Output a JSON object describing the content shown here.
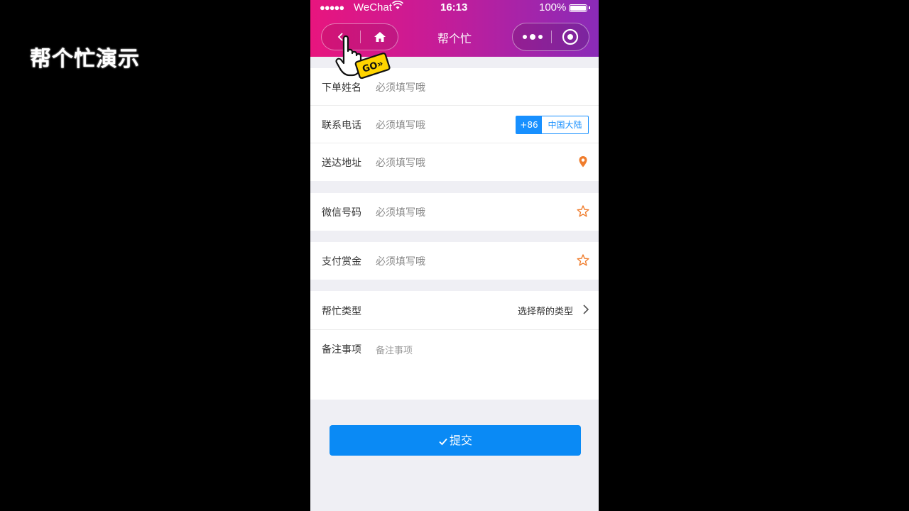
{
  "overlay": {
    "title": "帮个忙演示"
  },
  "status_bar": {
    "signal": "●●●●●",
    "carrier": "WeChat",
    "time": "16:13",
    "battery": "100%"
  },
  "nav": {
    "title": "帮个忙"
  },
  "form": {
    "placeholder": "必须填写哦",
    "name_label": "下单姓名",
    "phone_label": "联系电话",
    "phone_code": "+86",
    "phone_region": "中国大陆",
    "address_label": "送达地址",
    "wechat_label": "微信号码",
    "reward_label": "支付赏金",
    "type_label": "帮忙类型",
    "type_value": "选择帮的类型",
    "notes_label": "备注事项",
    "notes_placeholder": "备注事项"
  },
  "submit": {
    "label": "提交"
  },
  "cursor": {
    "badge": "GO»"
  },
  "colors": {
    "accent": "#0a8af5",
    "header_start": "#e8157e",
    "header_end": "#8a2bb8",
    "icon_orange": "#f07d2d"
  }
}
